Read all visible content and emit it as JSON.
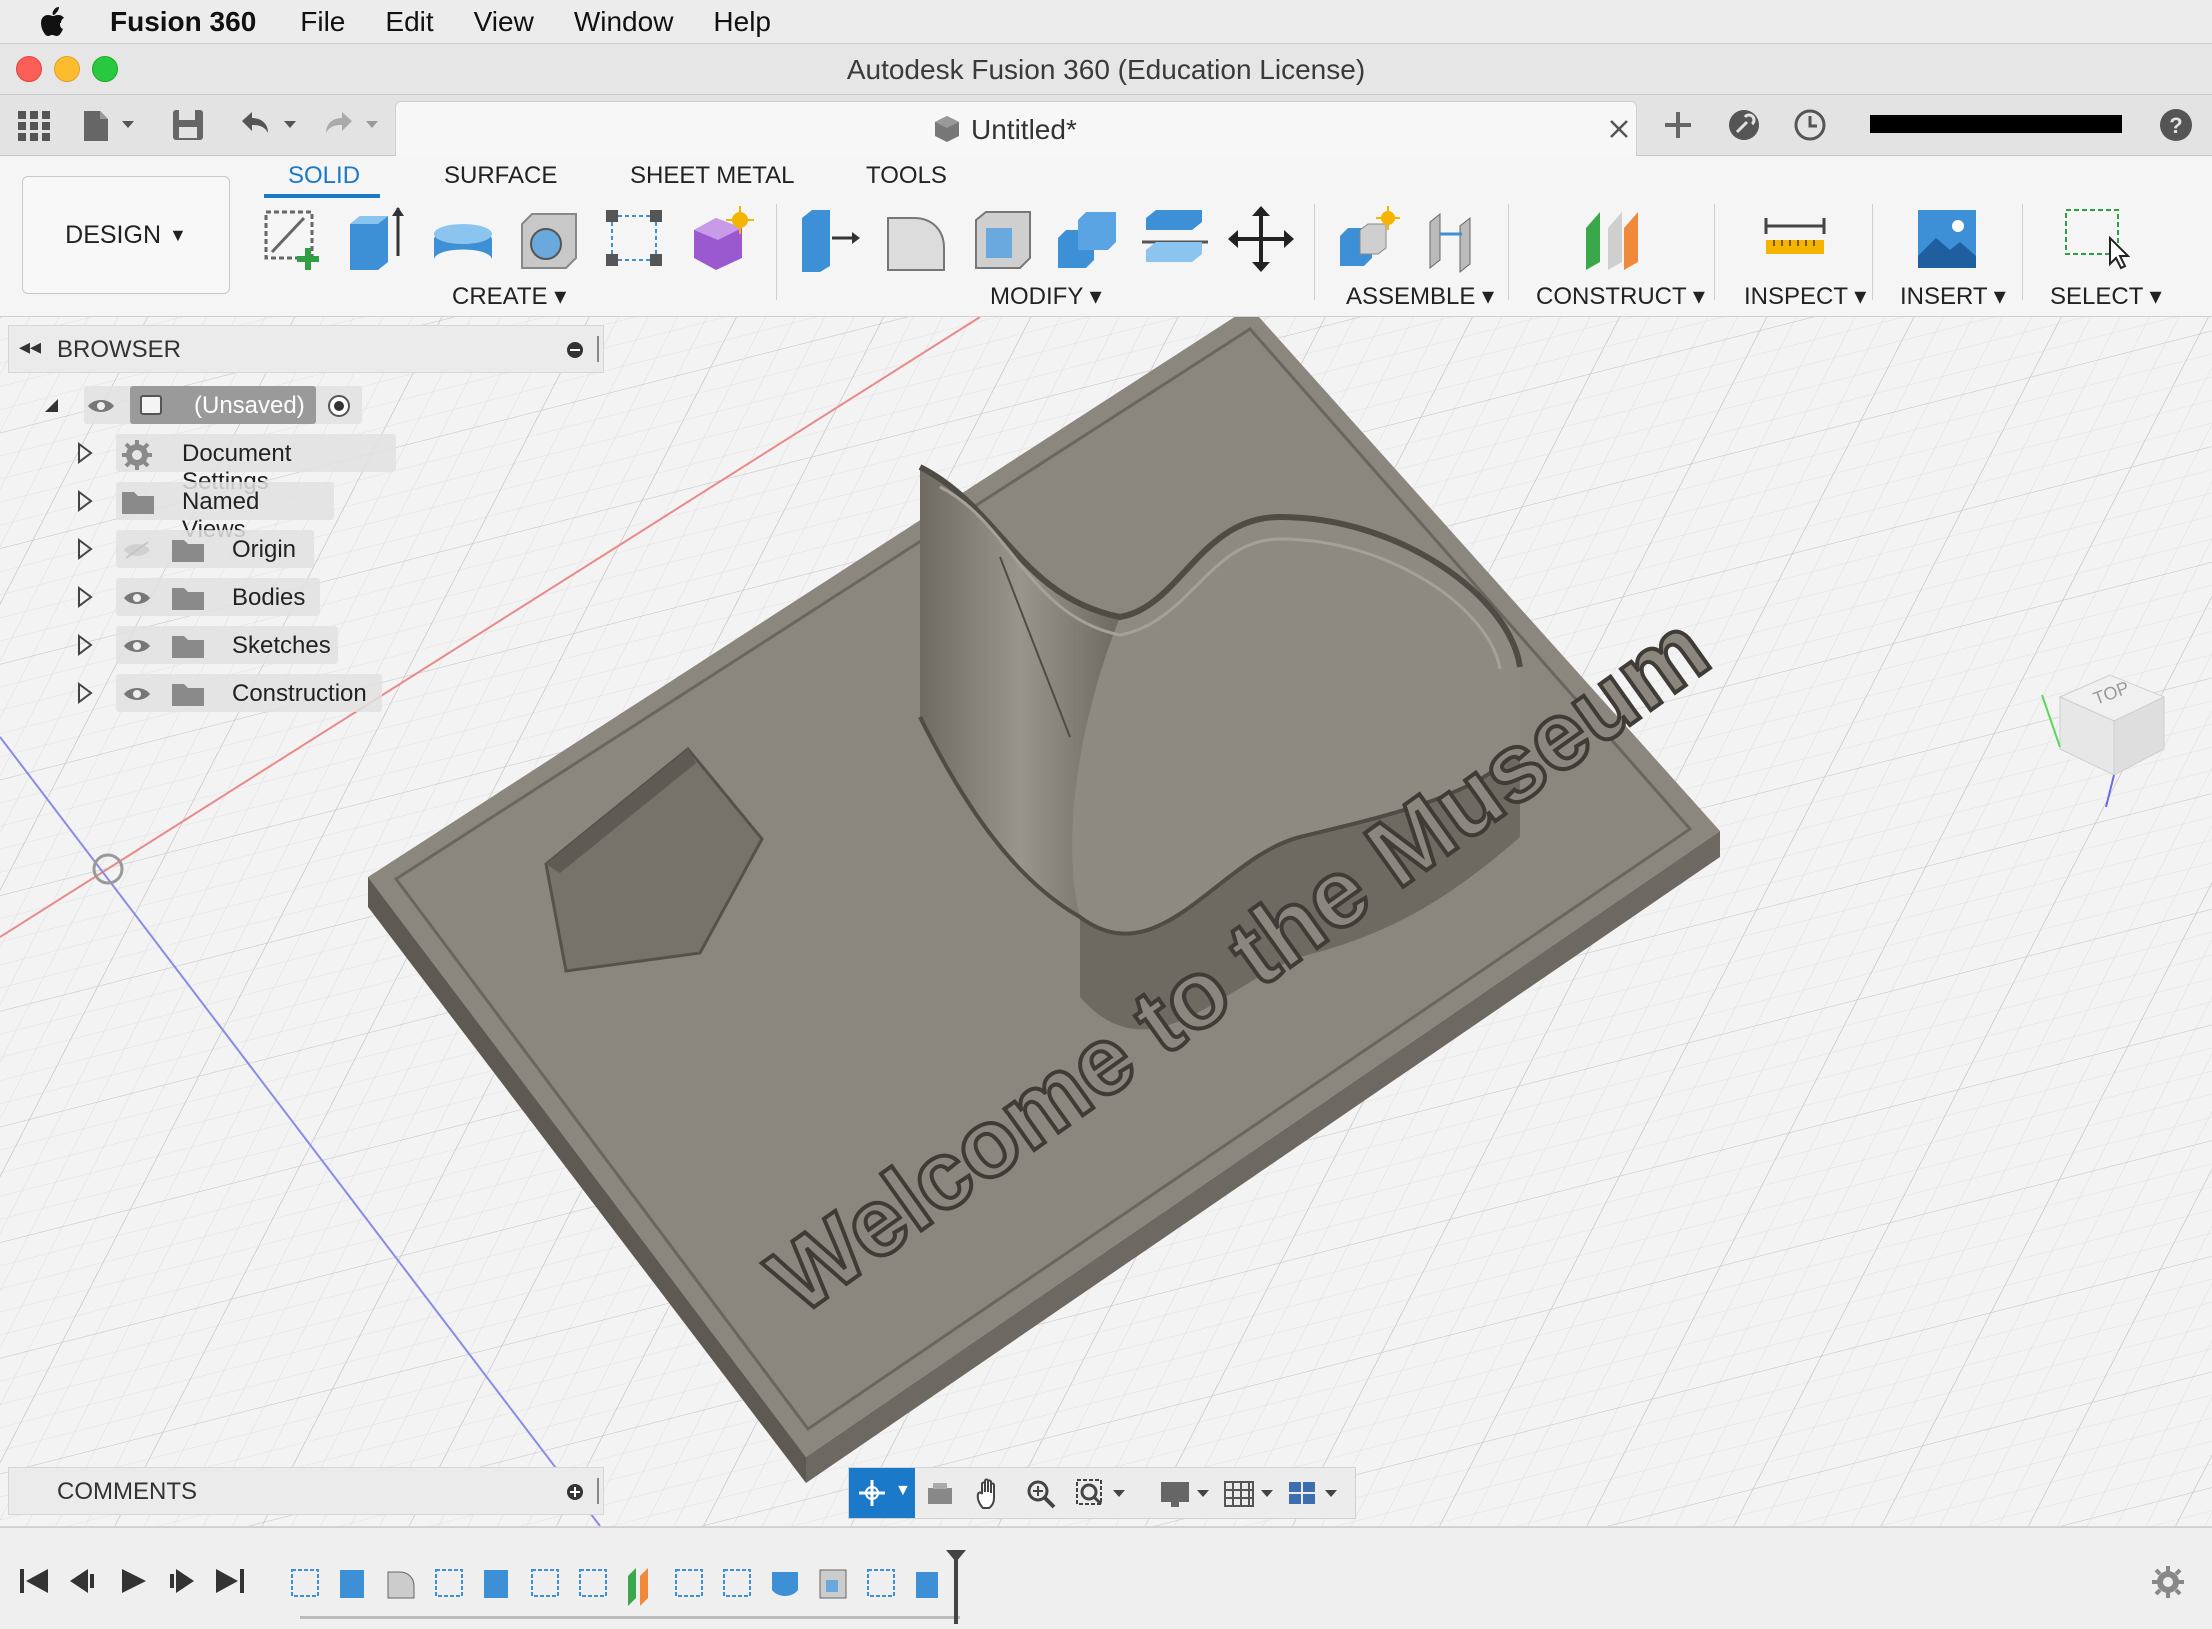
{
  "menubar": {
    "app_name": "Fusion 360",
    "items": [
      "File",
      "Edit",
      "View",
      "Window",
      "Help"
    ]
  },
  "window": {
    "title": "Autodesk Fusion 360 (Education License)"
  },
  "document_tab": {
    "title": "Untitled*"
  },
  "toolbar": {
    "workspace": "DESIGN",
    "tabs": [
      "SOLID",
      "SURFACE",
      "SHEET METAL",
      "TOOLS"
    ],
    "active_tab": "SOLID",
    "groups": [
      "CREATE",
      "MODIFY",
      "ASSEMBLE",
      "CONSTRUCT",
      "INSPECT",
      "INSERT",
      "SELECT"
    ]
  },
  "browser": {
    "title": "BROWSER",
    "root": "(Unsaved)",
    "items": [
      {
        "label": "Document Settings",
        "icon": "gear-icon"
      },
      {
        "label": "Named Views",
        "icon": "folder-icon"
      },
      {
        "label": "Origin",
        "icon": "folder-icon",
        "visibility": "hidden"
      },
      {
        "label": "Bodies",
        "icon": "folder-icon",
        "visibility": "visible"
      },
      {
        "label": "Sketches",
        "icon": "folder-icon",
        "visibility": "visible"
      },
      {
        "label": "Construction",
        "icon": "folder-icon",
        "visibility": "visible"
      }
    ]
  },
  "comments": {
    "title": "COMMENTS"
  },
  "model": {
    "engraved_text": "Welcome to the Museum"
  },
  "viewcube": {
    "face": "TOP"
  },
  "colors": {
    "accent": "#1a79c8",
    "model_body": "#8a857c",
    "canvas_bg": "#f3f3f3"
  }
}
